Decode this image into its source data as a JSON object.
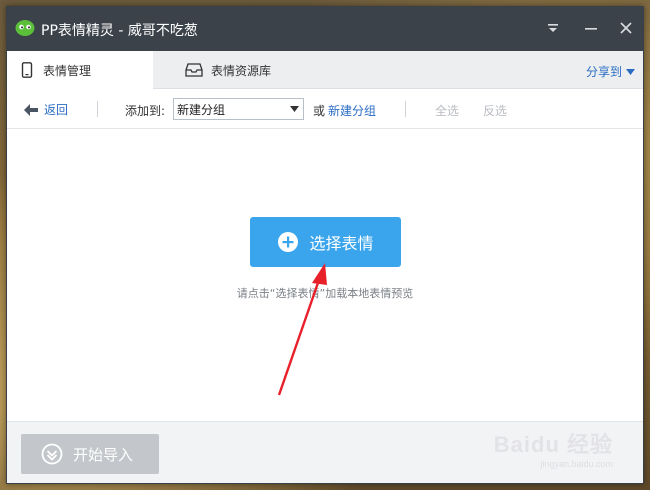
{
  "window": {
    "title": "PP表情精灵 - 威哥不吃葱",
    "controls": [
      "menu",
      "minimize",
      "close"
    ]
  },
  "tabs": [
    {
      "label": "表情管理",
      "icon": "phone-icon",
      "active": true
    },
    {
      "label": "表情资源库",
      "icon": "inbox-icon",
      "active": false
    }
  ],
  "share": {
    "label": "分享到"
  },
  "toolbar": {
    "back_label": "返回",
    "add_to_label": "添加到:",
    "group_value": "新建分组",
    "or_label": "或",
    "new_group_label": "新建分组",
    "select_all_label": "全选",
    "invert_label": "反选"
  },
  "main": {
    "choose_button_label": "选择表情",
    "hint_text": "请点击“选择表情”加载本地表情预览"
  },
  "footer": {
    "import_button_label": "开始导入"
  },
  "watermark": {
    "brand": "Baidu 经验",
    "url": "jingyan.baidu.com"
  },
  "colors": {
    "titlebar": "#3c424a",
    "accent": "#3aa5ec",
    "link": "#2a6cc4",
    "disabled_button": "#c3c6ca",
    "annotation_arrow": "#e8202a"
  }
}
